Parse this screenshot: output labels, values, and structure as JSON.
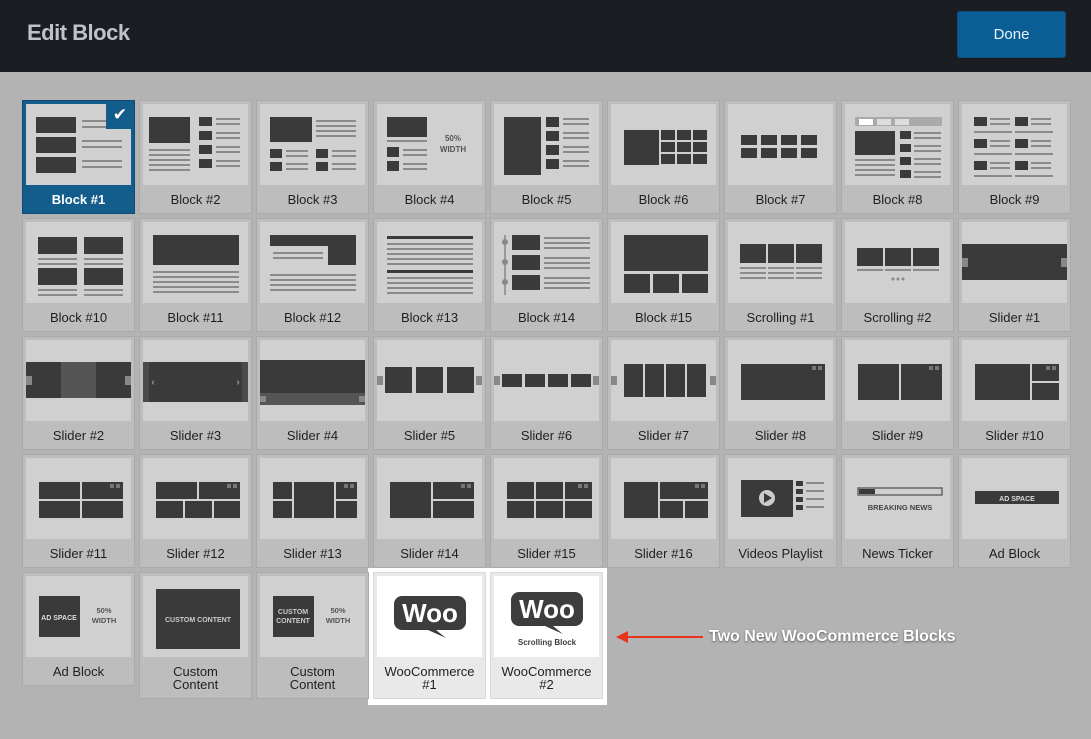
{
  "header": {
    "title": "Edit Block",
    "done_label": "Done"
  },
  "grid": {
    "tiles": [
      {
        "label": "Block #1",
        "thumb": "block1",
        "selected": true
      },
      {
        "label": "Block #2",
        "thumb": "block2"
      },
      {
        "label": "Block #3",
        "thumb": "block3"
      },
      {
        "label": "Block #4",
        "thumb": "block4",
        "text": "50%|WIDTH"
      },
      {
        "label": "Block #5",
        "thumb": "block5"
      },
      {
        "label": "Block #6",
        "thumb": "block6"
      },
      {
        "label": "Block #7",
        "thumb": "block7"
      },
      {
        "label": "Block #8",
        "thumb": "block8"
      },
      {
        "label": "Block #9",
        "thumb": "block9"
      },
      {
        "label": "Block #10",
        "thumb": "block10"
      },
      {
        "label": "Block #11",
        "thumb": "block11"
      },
      {
        "label": "Block #12",
        "thumb": "block12"
      },
      {
        "label": "Block #13",
        "thumb": "block13"
      },
      {
        "label": "Block #14",
        "thumb": "block14"
      },
      {
        "label": "Block #15",
        "thumb": "block15"
      },
      {
        "label": "Scrolling #1",
        "thumb": "scroll1"
      },
      {
        "label": "Scrolling #2",
        "thumb": "scroll2"
      },
      {
        "label": "Slider #1",
        "thumb": "slider1"
      },
      {
        "label": "Slider #2",
        "thumb": "slider2"
      },
      {
        "label": "Slider #3",
        "thumb": "slider3"
      },
      {
        "label": "Slider #4",
        "thumb": "slider4"
      },
      {
        "label": "Slider #5",
        "thumb": "slider5"
      },
      {
        "label": "Slider #6",
        "thumb": "slider6"
      },
      {
        "label": "Slider #7",
        "thumb": "slider7"
      },
      {
        "label": "Slider #8",
        "thumb": "slider8"
      },
      {
        "label": "Slider #9",
        "thumb": "slider9"
      },
      {
        "label": "Slider #10",
        "thumb": "slider10"
      },
      {
        "label": "Slider #11",
        "thumb": "slider11"
      },
      {
        "label": "Slider #12",
        "thumb": "slider12"
      },
      {
        "label": "Slider #13",
        "thumb": "slider13"
      },
      {
        "label": "Slider #14",
        "thumb": "slider14"
      },
      {
        "label": "Slider #15",
        "thumb": "slider15"
      },
      {
        "label": "Slider #16",
        "thumb": "slider16"
      },
      {
        "label": "Videos Playlist",
        "thumb": "videos"
      },
      {
        "label": "News Ticker",
        "thumb": "ticker",
        "text": "BREAKING NEWS"
      },
      {
        "label": "Ad Block",
        "thumb": "adblock",
        "text": "AD SPACE"
      },
      {
        "label": "Ad Block",
        "thumb": "adblock2",
        "text": "AD SPACE|50%|WIDTH"
      },
      {
        "label": "Custom\nContent",
        "thumb": "custom",
        "text": "CUSTOM CONTENT"
      },
      {
        "label": "Custom\nContent",
        "thumb": "custom2",
        "text": "CUSTOM|CONTENT|50%|WIDTH"
      },
      {
        "label": "WooCommerce\n#1",
        "thumb": "woo1",
        "text": "Woo",
        "woo": true
      },
      {
        "label": "WooCommerce\n#2",
        "thumb": "woo2",
        "text": "Woo|Scrolling Block",
        "woo": true
      }
    ]
  },
  "annotation": {
    "text": "Two New WooCommerce Blocks",
    "arrow_color": "#e8341c"
  },
  "colors": {
    "selected": "#135d8d",
    "header_bg": "#1a1d22",
    "panel_bg": "#b3b3b3",
    "shape": "#3a3a3a"
  }
}
